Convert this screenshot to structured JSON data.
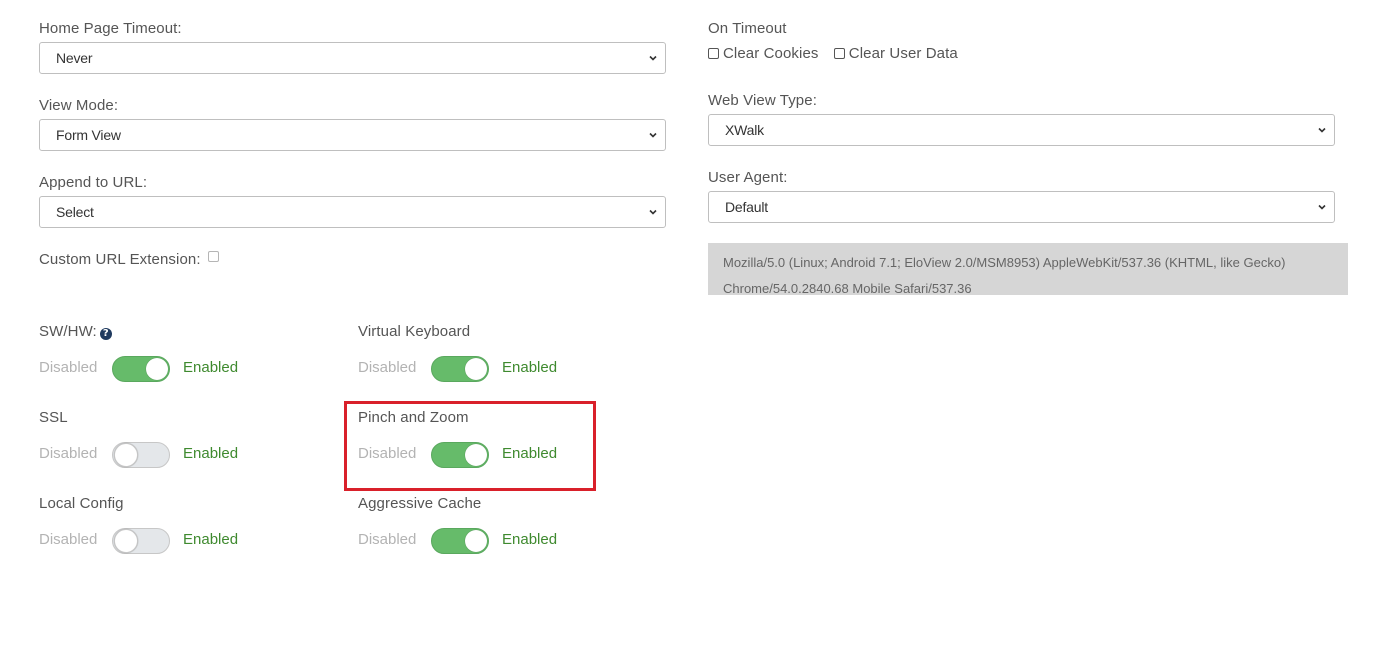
{
  "left_column": {
    "home_page_timeout": {
      "label": "Home Page Timeout:",
      "value": "Never"
    },
    "view_mode": {
      "label": "View Mode:",
      "value": "Form View"
    },
    "append_to_url": {
      "label": "Append to URL:",
      "value": "Select"
    },
    "custom_url_extension": {
      "label": "Custom URL Extension:",
      "checked": false
    }
  },
  "right_column": {
    "on_timeout": {
      "label": "On Timeout",
      "options": [
        {
          "label": "Clear Cookies",
          "checked": false
        },
        {
          "label": "Clear User Data",
          "checked": false
        }
      ]
    },
    "web_view_type": {
      "label": "Web View Type:",
      "value": "XWalk"
    },
    "user_agent": {
      "label": "User Agent:",
      "value": "Default",
      "string_line1": "Mozilla/5.0 (Linux; Android 7.1; EloView 2.0/MSM8953) AppleWebKit/537.36 (KHTML, like Gecko)",
      "string_line2": "Chrome/54.0.2840.68 Mobile Safari/537.36"
    }
  },
  "toggles": {
    "disabled_text": "Disabled",
    "enabled_text": "Enabled",
    "sw_hw": {
      "label": "SW/HW:",
      "enabled": true,
      "help_icon": "question-circle-icon"
    },
    "virtual_keyboard": {
      "label": "Virtual Keyboard",
      "enabled": true
    },
    "ssl": {
      "label": "SSL",
      "enabled": false
    },
    "pinch_and_zoom": {
      "label": "Pinch and Zoom",
      "enabled": true
    },
    "local_config": {
      "label": "Local Config",
      "enabled": false
    },
    "aggressive_cache": {
      "label": "Aggressive Cache",
      "enabled": true
    }
  },
  "colors": {
    "toggle_on": "#66bb6a",
    "toggle_off": "#e4e7ea",
    "enabled_text": "#3f8a2f",
    "highlight_border": "#d9202a",
    "user_agent_box": "#d6d6d6"
  }
}
